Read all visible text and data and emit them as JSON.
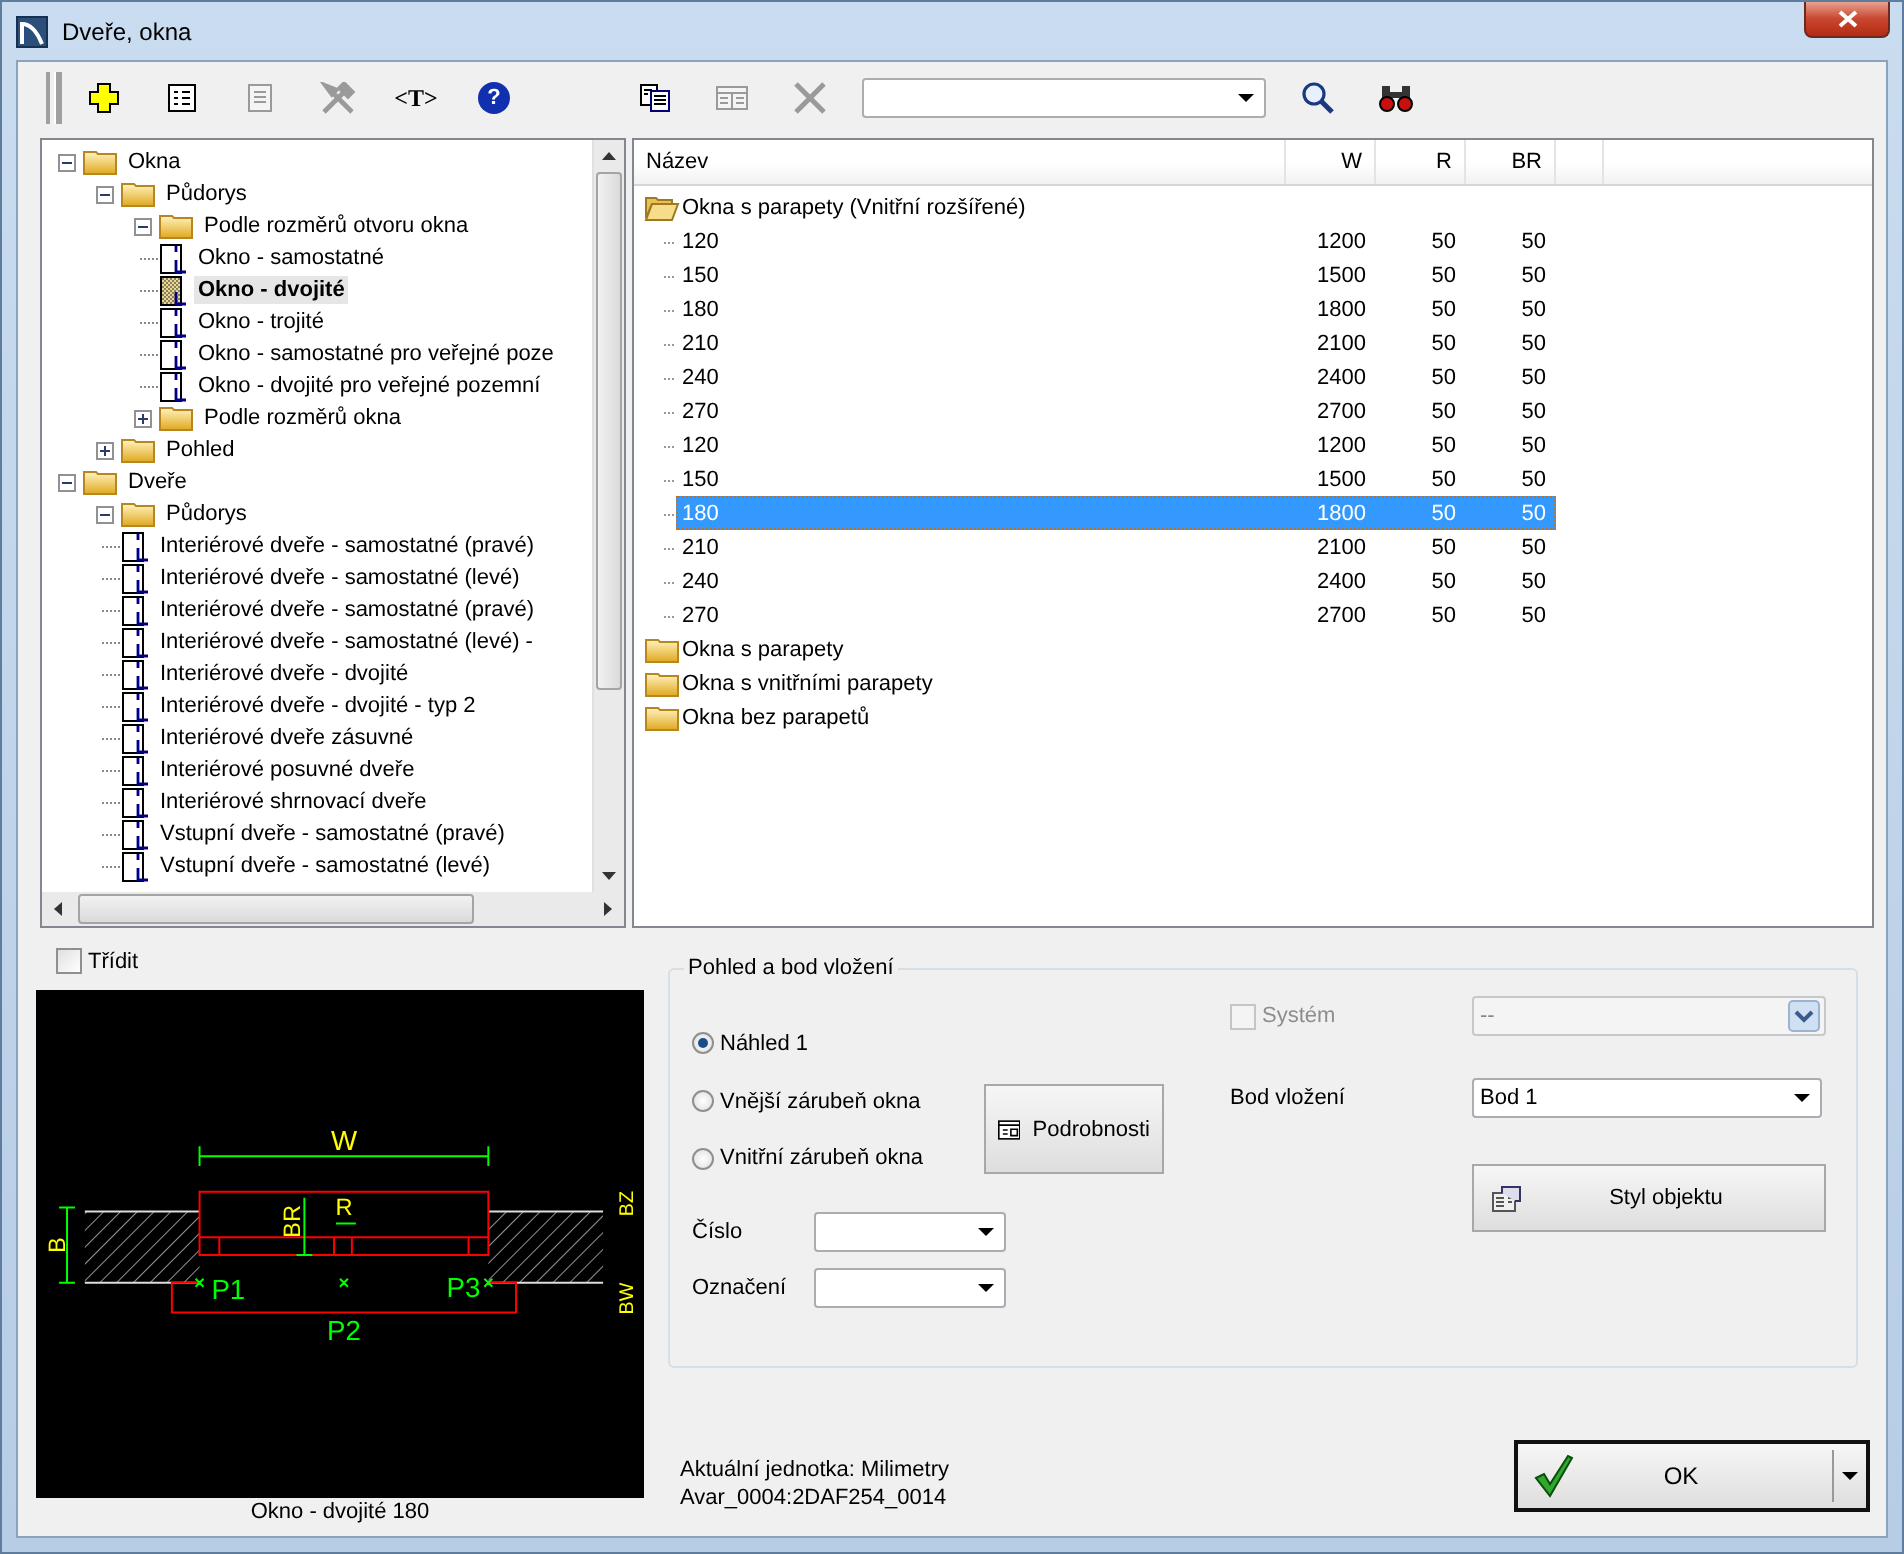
{
  "window": {
    "title": "Dveře, okna"
  },
  "toolbar": {
    "groups": [
      [
        {
          "kind": "add",
          "disabled": false
        },
        {
          "kind": "form",
          "disabled": false
        },
        {
          "kind": "page",
          "disabled": true
        },
        {
          "kind": "tools",
          "disabled": true
        },
        {
          "kind": "text",
          "label": "<T>",
          "disabled": false
        },
        {
          "kind": "help",
          "label": "?",
          "disabled": false
        }
      ],
      [
        {
          "kind": "copy",
          "disabled": false
        },
        {
          "kind": "table",
          "disabled": true
        },
        {
          "kind": "delete",
          "disabled": true
        },
        {
          "kind": "combo"
        },
        {
          "kind": "search",
          "disabled": false
        },
        {
          "kind": "find",
          "disabled": false
        }
      ]
    ]
  },
  "tree": [
    {
      "kind": "folder",
      "label": "Okna",
      "expanded": true,
      "selected": false,
      "children": [
        {
          "kind": "folder",
          "label": "Půdorys",
          "expanded": true,
          "selected": false,
          "children": [
            {
              "kind": "folder",
              "label": "Podle rozměrů otvoru okna",
              "expanded": true,
              "selected": false,
              "children": [
                {
                  "kind": "item",
                  "label": "Okno - samostatné",
                  "selected": false
                },
                {
                  "kind": "item",
                  "label": "Okno - dvojité",
                  "selected": true
                },
                {
                  "kind": "item",
                  "label": "Okno - trojité",
                  "selected": false
                },
                {
                  "kind": "item",
                  "label": "Okno - samostatné pro veřejné poze",
                  "selected": false
                },
                {
                  "kind": "item",
                  "label": "Okno - dvojité pro veřejné pozemní",
                  "selected": false
                }
              ]
            },
            {
              "kind": "folder",
              "label": "Podle rozměrů okna",
              "expanded": false,
              "selected": false
            }
          ]
        },
        {
          "kind": "folder",
          "label": "Pohled",
          "expanded": false,
          "selected": false
        }
      ]
    },
    {
      "kind": "folder",
      "label": "Dveře",
      "expanded": true,
      "selected": false,
      "children": [
        {
          "kind": "folder",
          "label": "Půdorys",
          "expanded": true,
          "selected": false,
          "children": [
            {
              "kind": "item",
              "label": "Interiérové dveře - samostatné (pravé)",
              "selected": false
            },
            {
              "kind": "item",
              "label": "Interiérové dveře - samostatné (levé)",
              "selected": false
            },
            {
              "kind": "item",
              "label": "Interiérové dveře - samostatné (pravé)",
              "selected": false
            },
            {
              "kind": "item",
              "label": "Interiérové dveře - samostatné (levé) -",
              "selected": false
            },
            {
              "kind": "item",
              "label": "Interiérové dveře - dvojité",
              "selected": false
            },
            {
              "kind": "item",
              "label": "Interiérové dveře - dvojité - typ 2",
              "selected": false
            },
            {
              "kind": "item",
              "label": "Interiérové dveře zásuvné",
              "selected": false
            },
            {
              "kind": "item",
              "label": "Interiérové posuvné dveře",
              "selected": false
            },
            {
              "kind": "item",
              "label": "Interiérové shrnovací dveře",
              "selected": false
            },
            {
              "kind": "item",
              "label": "Vstupní dveře - samostatné (pravé)",
              "selected": false
            },
            {
              "kind": "item",
              "label": "Vstupní dveře - samostatné (levé)",
              "selected": false
            }
          ]
        }
      ]
    }
  ],
  "list": {
    "columns": [
      "Název",
      "W",
      "R",
      "BR"
    ],
    "groups": [
      {
        "name": "Okna s parapety (Vnitřní rozšířené)",
        "expanded": true,
        "rows": [
          {
            "cells": [
              "120",
              "1200",
              "50",
              "50"
            ],
            "selected": false
          },
          {
            "cells": [
              "150",
              "1500",
              "50",
              "50"
            ],
            "selected": false
          },
          {
            "cells": [
              "180",
              "1800",
              "50",
              "50"
            ],
            "selected": false
          },
          {
            "cells": [
              "210",
              "2100",
              "50",
              "50"
            ],
            "selected": false
          },
          {
            "cells": [
              "240",
              "2400",
              "50",
              "50"
            ],
            "selected": false
          },
          {
            "cells": [
              "270",
              "2700",
              "50",
              "50"
            ],
            "selected": false
          },
          {
            "cells": [
              "120",
              "1200",
              "50",
              "50"
            ],
            "selected": false
          },
          {
            "cells": [
              "150",
              "1500",
              "50",
              "50"
            ],
            "selected": false
          },
          {
            "cells": [
              "180",
              "1800",
              "50",
              "50"
            ],
            "selected": true
          },
          {
            "cells": [
              "210",
              "2100",
              "50",
              "50"
            ],
            "selected": false
          },
          {
            "cells": [
              "240",
              "2400",
              "50",
              "50"
            ],
            "selected": false
          },
          {
            "cells": [
              "270",
              "2700",
              "50",
              "50"
            ],
            "selected": false
          }
        ]
      },
      {
        "name": "Okna s parapety",
        "expanded": false
      },
      {
        "name": "Okna s vnitřními parapety",
        "expanded": false
      },
      {
        "name": "Okna bez parapetů",
        "expanded": false
      }
    ]
  },
  "sort": {
    "label": "Třídit",
    "checked": false
  },
  "preview": {
    "labels": [
      "W",
      "BZ",
      "BR",
      "R",
      "B",
      "P1",
      "P3",
      "P2",
      "BW"
    ],
    "caption": "Okno - dvojité 180"
  },
  "options": {
    "title": "Pohled a bod vložení",
    "views": [
      {
        "label": "Náhled 1",
        "selected": true
      },
      {
        "label": "Vnější zárubeň okna",
        "selected": false
      },
      {
        "label": "Vnitřní zárubeň okna",
        "selected": false
      }
    ],
    "details_button": "Podrobnosti",
    "fields": [
      {
        "label": "Číslo"
      },
      {
        "label": "Označení"
      }
    ],
    "system": {
      "label": "Systém",
      "checked": false,
      "disabled": true
    },
    "system_select": {
      "value": "--",
      "disabled": true
    },
    "insert_point": {
      "label": "Bod vložení",
      "value": "Bod 1"
    },
    "style_button": "Styl objektu"
  },
  "footer": {
    "unit": "Aktuální jednotka: Milimetry",
    "id": "Avar_0004:2DAF254_0014",
    "ok": "OK"
  }
}
